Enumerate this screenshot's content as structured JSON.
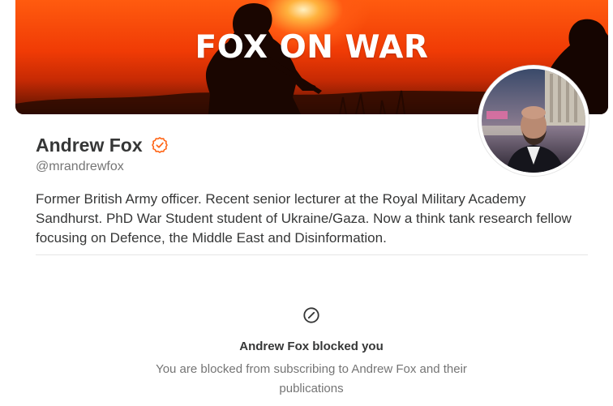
{
  "banner": {
    "title": "FOX ON WAR"
  },
  "profile": {
    "name": "Andrew Fox",
    "handle": "@mrandrewfox",
    "verified_icon": "verified-badge-icon",
    "bio": "Former British Army officer. Recent senior lecturer at the Royal Military Academy Sandhurst. PhD War Student student of Ukraine/Gaza. Now a think tank research fellow focusing on Defence, the Middle East and Disinformation.",
    "accent_color": "#ff6719"
  },
  "blocked": {
    "icon": "blocked-circle-icon",
    "title": "Andrew Fox blocked you",
    "description": "You are blocked from subscribing to Andrew Fox and their publications"
  }
}
